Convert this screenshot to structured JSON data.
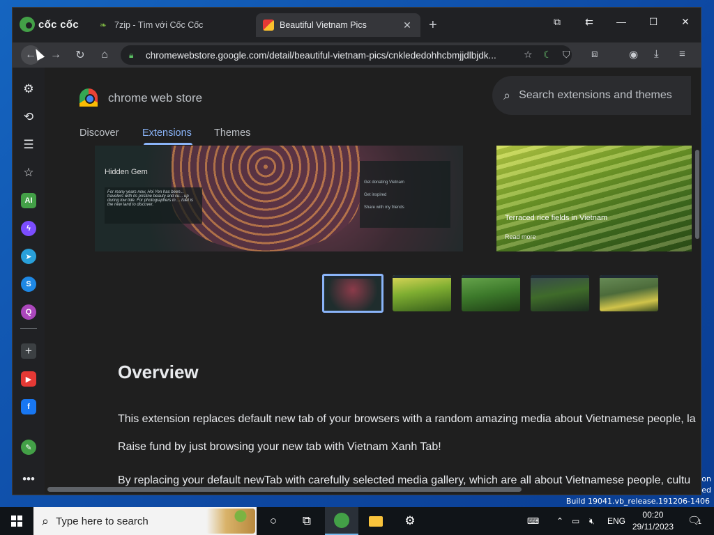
{
  "desktop": {
    "watermark_build": "Build 19041.vb_release.191206-1406",
    "watermark_side1": "on",
    "watermark_side2": "ed"
  },
  "browser": {
    "brand": "cốc cốc",
    "tabs": [
      {
        "label": "7zip - Tìm với Cốc Cốc",
        "icon": "leaf-icon",
        "active": false
      },
      {
        "label": "Beautiful Vietnam Pics",
        "icon": "picture-icon",
        "active": true
      }
    ],
    "url": "chromewebstore.google.com/detail/beautiful-vietnam-pics/cnklededohhcbmjjdlbjdk..."
  },
  "store": {
    "title": "chrome web store",
    "search_placeholder": "Search extensions and themes",
    "nav_tabs": [
      "Discover",
      "Extensions",
      "Themes"
    ],
    "active_tab": "Extensions",
    "hero": {
      "gem_label": "Hidden Gem",
      "card_text": "For many years now, Hoi Yen has been... travelers with its pristine beauty and cu... up during low tide. For photographers in ... Islet is the new land to discover.",
      "panel_items": [
        "Get donating Vietnam",
        "Get inspired",
        "Share with my friends"
      ],
      "side_caption": "Terraced rice fields in Vietnam",
      "side_link": "Read more"
    },
    "overview_heading": "Overview",
    "paragraphs": [
      "This extension replaces default new tab of your browsers with a random amazing media about Vietnamese people, la",
      "Raise fund by just browsing your new tab with Vietnam Xanh Tab!",
      "By replacing your default newTab with carefully selected media gallery, which are all about Vietnamese people, cultu"
    ]
  },
  "taskbar": {
    "search_placeholder": "Type here to search",
    "language": "ENG",
    "time": "00:20",
    "date": "29/11/2023",
    "notification_count": "1"
  }
}
